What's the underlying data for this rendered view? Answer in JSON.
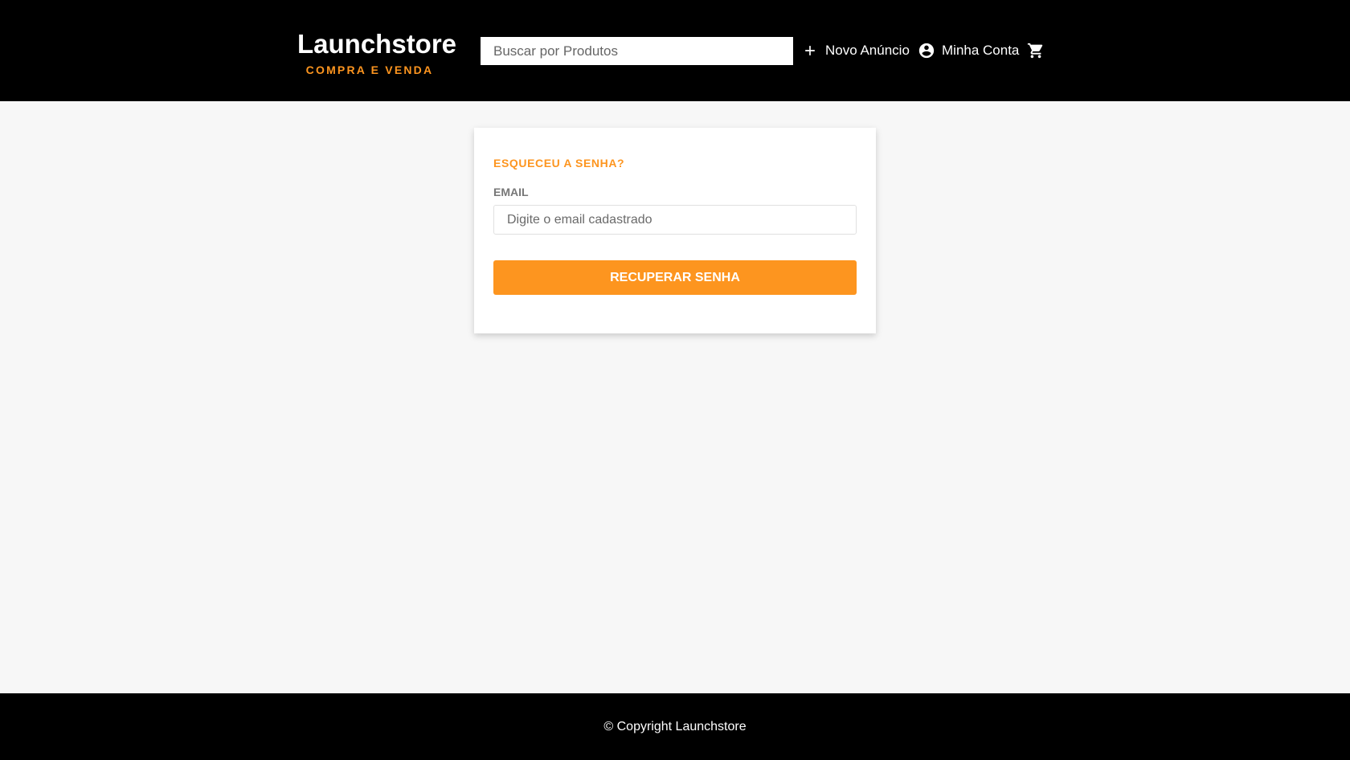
{
  "header": {
    "logo_title": "Launchstore",
    "logo_subtitle": "COMPRA E VENDA",
    "search_placeholder": "Buscar por Produtos",
    "nav": {
      "new_ad_label": "Novo Anúncio",
      "new_ad_icon": "plus-icon",
      "account_label": "Minha Conta",
      "account_icon": "account-circle-icon",
      "cart_icon": "shopping-cart-icon"
    }
  },
  "form": {
    "title": "ESQUECEU A SENHA?",
    "email_label": "EMAIL",
    "email_placeholder": "Digite o email cadastrado",
    "email_value": "",
    "submit_label": "RECUPERAR SENHA"
  },
  "footer": {
    "copyright": "© Copyright Launchstore"
  },
  "colors": {
    "header_bg": "#000000",
    "accent": "#fd951f",
    "page_bg": "#f7f7f7",
    "card_bg": "#ffffff",
    "label": "#777777"
  }
}
